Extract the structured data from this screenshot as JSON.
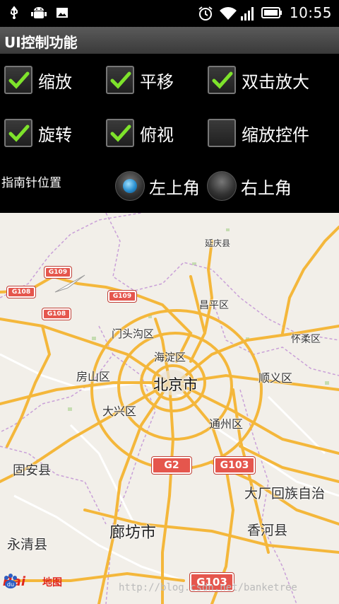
{
  "status_bar": {
    "time": "10:55",
    "icons": [
      "usb-icon",
      "android-debug-icon",
      "image-icon",
      "alarm-icon",
      "wifi-icon",
      "signal-icon",
      "battery-icon"
    ]
  },
  "title_bar": {
    "title": "UI控制功能"
  },
  "options": {
    "zoom": {
      "label": "缩放",
      "checked": true
    },
    "pan": {
      "label": "平移",
      "checked": true
    },
    "double_tap_zoom": {
      "label": "双击放大",
      "checked": true
    },
    "rotate": {
      "label": "旋转",
      "checked": true
    },
    "overlook": {
      "label": "俯视",
      "checked": true
    },
    "zoom_controls": {
      "label": "缩放控件",
      "checked": false
    }
  },
  "compass": {
    "label": "指南针位置",
    "options": [
      {
        "label": "左上角",
        "selected": true
      },
      {
        "label": "右上角",
        "selected": false
      }
    ]
  },
  "map": {
    "places": {
      "yanqing": "延庆县",
      "changping": "昌平区",
      "huairou": "怀柔区",
      "mentougou": "门头沟区",
      "haidian": "海淀区",
      "fangshan": "房山区",
      "beijing": "北京市",
      "shunyi": "顺义区",
      "daxing": "大兴区",
      "tongzhou": "通州区",
      "gu_an": "固安县",
      "dachang": "大厂回族自治",
      "yongqing": "永清县",
      "langfang": "廊坊市",
      "xianghe": "香河县"
    },
    "shields": {
      "g109a": "G109",
      "g109b": "G109",
      "g108a": "G108",
      "g108b": "G108",
      "g2": "G2",
      "g103a": "G103",
      "g103b": "G103"
    },
    "logo": {
      "bai": "Bai",
      "ditu": "地图"
    },
    "watermark": "http://blog.csdn.net/banketree",
    "colors": {
      "highway": "#f4b73b",
      "road": "#ffffff",
      "land": "#f2efe9",
      "shield": "#e5564d"
    }
  }
}
